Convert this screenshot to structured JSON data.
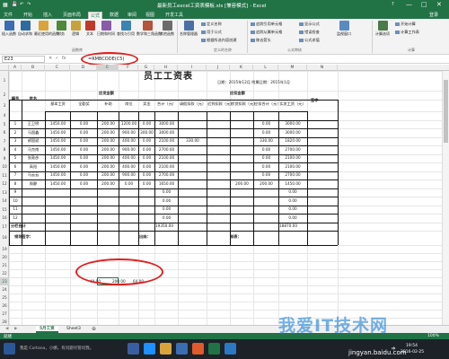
{
  "window": {
    "title": "最新员工excel工资表模板.xls [兼容模式] - Excel",
    "help": "?",
    "controls": [
      "—",
      "□",
      "✕"
    ]
  },
  "tabs": [
    "文件",
    "开始",
    "插入",
    "页面布局",
    "公式",
    "数据",
    "审阅",
    "视图",
    "开发工具",
    "登录"
  ],
  "active_tab": 4,
  "ribbon": {
    "big_buttons": [
      {
        "label": "插入函数",
        "icon": "function-icon",
        "color": "#3b6db3"
      },
      {
        "label": "自动求和",
        "icon": "autosum-icon",
        "color": "#2e6b9e"
      },
      {
        "label": "最近使用的函数",
        "icon": "recent-icon",
        "color": "#d9a43b"
      },
      {
        "label": "财务",
        "icon": "finance-icon",
        "color": "#4f8a3a"
      },
      {
        "label": "逻辑",
        "icon": "logic-icon",
        "color": "#c7a23a"
      },
      {
        "label": "文本",
        "icon": "text-icon",
        "color": "#c0392b"
      },
      {
        "label": "日期和时间",
        "icon": "datetime-icon",
        "color": "#8a5ba8"
      },
      {
        "label": "查找与引用",
        "icon": "lookup-icon",
        "color": "#3b84b3"
      },
      {
        "label": "数学和三角函数",
        "icon": "math-icon",
        "color": "#b3543b"
      },
      {
        "label": "其他函数",
        "icon": "more-functions-icon",
        "color": "#6b6b6b"
      },
      {
        "label": "名称管理器",
        "icon": "name-manager-icon",
        "color": "#4a6fa5"
      },
      {
        "label": "监视窗口",
        "icon": "watch-window-icon",
        "color": "#5a8ac0"
      },
      {
        "label": "计算选项",
        "icon": "calc-options-icon",
        "color": "#4a7a4a"
      }
    ],
    "small_buttons": [
      "定义名称",
      "用于公式",
      "根据所选内容创建",
      "追踪引用单元格",
      "追踪从属单元格",
      "移去箭头",
      "显示公式",
      "错误检查",
      "公式求值",
      "开始计算",
      "计算工作表"
    ],
    "groups": [
      "函数库",
      "定义的名称",
      "公式审核",
      "计算"
    ]
  },
  "formula_bar": {
    "name_box": "E23",
    "formula": "=RMBCODE(C5)"
  },
  "columns": [
    "A",
    "B",
    "C",
    "D",
    "E",
    "F",
    "G",
    "H",
    "I",
    "J",
    "K",
    "L",
    "M",
    "N"
  ],
  "selected_column": "E",
  "rows": [
    "1",
    "2",
    "3",
    "4",
    "5",
    "6",
    "7",
    "8",
    "9",
    "10",
    "11",
    "12",
    "13",
    "14",
    "15",
    "16",
    "17",
    "18",
    "19",
    "20",
    "21",
    "22",
    "23",
    "24",
    "25",
    "26",
    "27",
    "28"
  ],
  "selected_row": "23",
  "sheet": {
    "title": "员工工资表",
    "meta": "日期：2015年12月 附属日期：2015年1月",
    "header_no": "编号",
    "header_name": "姓名",
    "header_pay": "应发金额",
    "header_deduct": "应扣金额",
    "sub_headers": [
      "基本工资",
      "全勤奖",
      "补助",
      "岗位",
      "奖金",
      "合计（元）",
      "请假扣款（元）",
      "迟到扣款（元）",
      "房贷扣款（元）",
      "应扣合计（元）",
      "实发工资（元）"
    ],
    "header_sign": "签字",
    "employees": [
      {
        "no": "1",
        "name": "王卫明",
        "vals": [
          "1450.00",
          "0.00",
          "200.00",
          "1200.00",
          "0.00",
          "3000.00",
          "",
          "",
          "",
          "0.00",
          "3000.00"
        ]
      },
      {
        "no": "2",
        "name": "马国鑫",
        "vals": [
          "1450.00",
          "0.00",
          "200.00",
          "900.00",
          "300.00",
          "3000.00",
          "",
          "",
          "",
          "0.00",
          "3000.00"
        ]
      },
      {
        "no": "3",
        "name": "郝国斌",
        "vals": [
          "1450.00",
          "0.00",
          "200.00",
          "400.00",
          "0.00",
          "2100.00",
          "330.00",
          "",
          "",
          "330.00",
          "1820.00"
        ]
      },
      {
        "no": "4",
        "name": "马克南",
        "vals": [
          "1450.00",
          "0.00",
          "200.00",
          "900.00",
          "0.00",
          "2700.00",
          "",
          "",
          "",
          "0.00",
          "2700.00"
        ]
      },
      {
        "no": "5",
        "name": "张敦彦",
        "vals": [
          "1450.00",
          "0.00",
          "200.00",
          "400.00",
          "0.00",
          "2100.00",
          "",
          "",
          "",
          "0.00",
          "2100.00"
        ]
      },
      {
        "no": "6",
        "name": "高阳",
        "vals": [
          "1450.00",
          "0.00",
          "200.00",
          "400.00",
          "0.00",
          "2100.00",
          "",
          "",
          "",
          "0.00",
          "2100.00"
        ]
      },
      {
        "no": "7",
        "name": "马云云",
        "vals": [
          "1450.00",
          "0.00",
          "200.00",
          "900.00",
          "0.00",
          "2700.00",
          "",
          "",
          "",
          "0.00",
          "2700.00"
        ]
      },
      {
        "no": "8",
        "name": "周静",
        "vals": [
          "1450.00",
          "0.00",
          "200.00",
          "0.00",
          "0.00",
          "1650.00",
          "",
          "",
          "200.00",
          "200.00",
          "1450.00"
        ]
      },
      {
        "no": "9",
        "name": "",
        "vals": [
          "",
          "",
          "",
          "",
          "",
          "0.00",
          "",
          "",
          "",
          "",
          "0.00"
        ]
      },
      {
        "no": "10",
        "name": "",
        "vals": [
          "",
          "",
          "",
          "",
          "",
          "0.00",
          "",
          "",
          "",
          "",
          "0.00"
        ]
      },
      {
        "no": "11",
        "name": "",
        "vals": [
          "",
          "",
          "",
          "",
          "",
          "0.00",
          "",
          "",
          "",
          "",
          "0.00"
        ]
      },
      {
        "no": "12",
        "name": "",
        "vals": [
          "",
          "",
          "",
          "",
          "",
          "0.00",
          "",
          "",
          "",
          "",
          "0.00"
        ]
      }
    ],
    "subtotal_label": "分栏合计",
    "subtotal_values": [
      "19350.00",
      "18870.00"
    ],
    "sign_leader": "领导签字：",
    "sign_cashier": "出纳：",
    "sign_maker": "制表：",
    "highlight_values": [
      "40.00",
      "200.00",
      "64.00"
    ]
  },
  "sheet_tabs": [
    "5月工资",
    "Sheet3"
  ],
  "active_sheet": 0,
  "status": {
    "left": "就绪",
    "zoom": "100%"
  },
  "taskbar": {
    "search": "我是 Cortana，小娜。有问题尽管问我。",
    "time": "19:54",
    "date": "2016-02-25",
    "lang": "中"
  },
  "watermark": "我爱IT技术网",
  "watermark_url": "jingyan.baidu.com",
  "colors": {
    "excel_green": "#217346",
    "annotation_red": "#e02020"
  }
}
